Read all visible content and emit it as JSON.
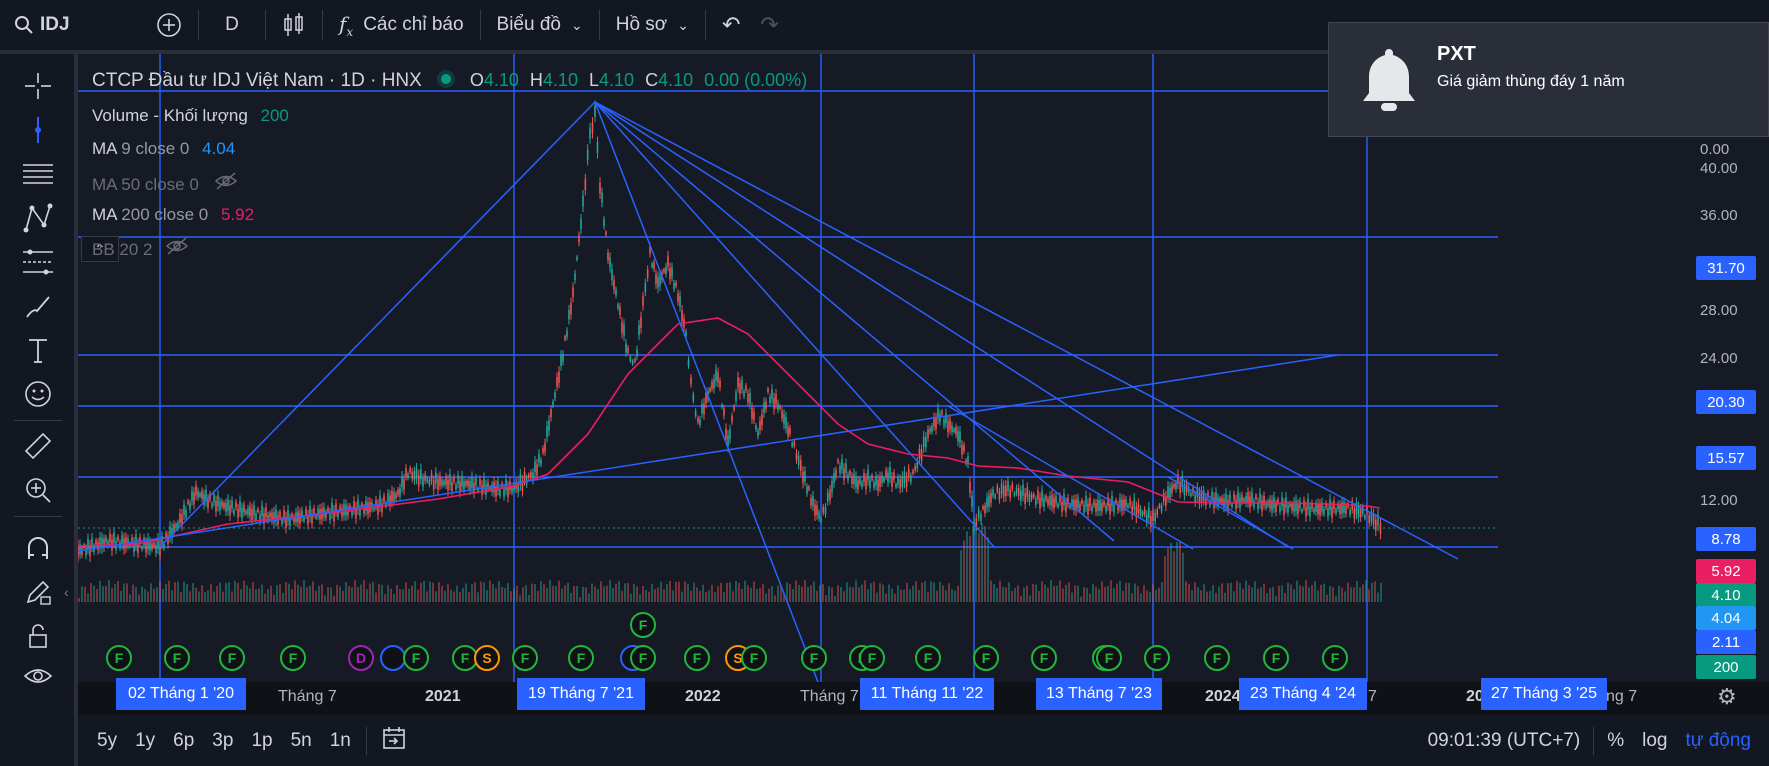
{
  "topbar": {
    "symbol": "IDJ",
    "interval": "D",
    "indicators_label": "Các chỉ báo",
    "chart_type_label": "Biểu đồ",
    "profile_label": "Hồ sơ"
  },
  "legend": {
    "title": "CTCP Đầu tư IDJ Việt Nam · 1D · HNX",
    "o_label": "O",
    "o_value": "4.10",
    "h_label": "H",
    "h_value": "4.10",
    "l_label": "L",
    "l_value": "4.10",
    "c_label": "C",
    "c_value": "4.10",
    "change": "0.00 (0.00%)",
    "volume_label": "Volume - Khối lượng",
    "volume_value": "200",
    "ma9_label": "MA",
    "ma9_params": "9 close 0",
    "ma9_value": "4.04",
    "ma50_label": "MA 50 close 0",
    "ma200_label": "MA",
    "ma200_params": "200 close 0",
    "ma200_value": "5.92",
    "bb_label": "BB 20 2"
  },
  "price_axis": {
    "ticks": [
      "40.00",
      "36.00",
      "28.00",
      "24.00",
      "12.00"
    ],
    "partial_tick": "0.00",
    "tags": [
      {
        "value": "31.70",
        "color": "#2962ff"
      },
      {
        "value": "20.30",
        "color": "#2962ff"
      },
      {
        "value": "15.57",
        "color": "#2962ff"
      },
      {
        "value": "8.78",
        "color": "#2962ff"
      },
      {
        "value": "5.92",
        "color": "#e91e63"
      },
      {
        "value": "4.10",
        "color": "#089981"
      },
      {
        "value": "4.04",
        "color": "#2196f3"
      },
      {
        "value": "2.11",
        "color": "#2962ff"
      },
      {
        "value": "200",
        "color": "#089981"
      }
    ]
  },
  "time_axis": {
    "labels": [
      "Tháng 7",
      "2021",
      "2022",
      "Tháng 7",
      "2024",
      "7",
      "20",
      "ng 7"
    ],
    "date_tags": [
      "02 Tháng 1 '20",
      "19 Tháng 7 '21",
      "11 Tháng 11 '22",
      "13 Tháng 7 '23",
      "23 Tháng 4 '24",
      "27 Tháng 3 '25"
    ]
  },
  "flags": {
    "F": "F",
    "S": "S",
    "D": "D"
  },
  "notification": {
    "title": "PXT",
    "message": "Giá giảm thủng đáy 1 năm"
  },
  "bottombar": {
    "ranges": [
      "5y",
      "1y",
      "6p",
      "3p",
      "1p",
      "5n",
      "1n"
    ],
    "clock": "09:01:39 (UTC+7)",
    "percent": "%",
    "log": "log",
    "auto": "tự động"
  },
  "colors": {
    "accent": "#2962ff",
    "up": "#26a69a",
    "down": "#ef5350",
    "ma200": "#e91e63",
    "ma9": "#2196f3"
  }
}
